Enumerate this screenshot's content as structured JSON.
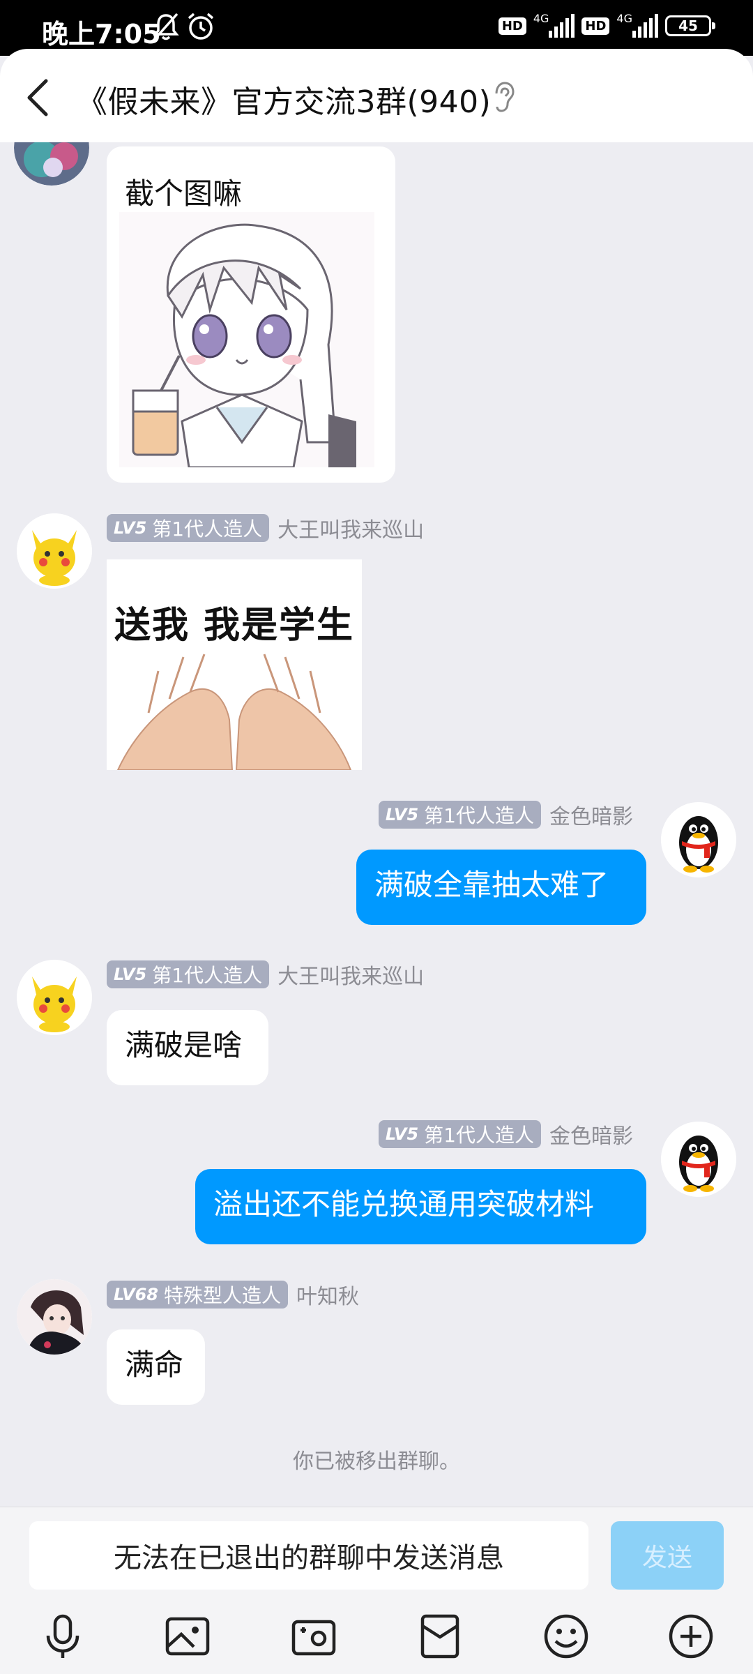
{
  "status_bar": {
    "time": "晚上7:05",
    "hd1": "HD",
    "net1": "4G",
    "hd2": "HD",
    "net2": "4G",
    "battery": "45"
  },
  "header": {
    "title": "《假未来》官方交流3群(940)"
  },
  "messages": [
    {
      "text": "截个图嘛"
    },
    {
      "badge_lv": "LV5",
      "badge_title": "第1代人造人",
      "sender": "大王叫我来巡山",
      "sticker_text": "送我 我是学生"
    },
    {
      "badge_lv": "LV5",
      "badge_title": "第1代人造人",
      "sender": "金色暗影",
      "text": "满破全靠抽太难了"
    },
    {
      "badge_lv": "LV5",
      "badge_title": "第1代人造人",
      "sender": "大王叫我来巡山",
      "text": "满破是啥"
    },
    {
      "badge_lv": "LV5",
      "badge_title": "第1代人造人",
      "sender": "金色暗影",
      "text": "溢出还不能兑换通用突破材料"
    },
    {
      "badge_lv": "LV68",
      "badge_title": "特殊型人造人",
      "sender": "叶知秋",
      "text": "满命"
    }
  ],
  "system_message": "你已被移出群聊。",
  "input": {
    "disabled_text": "无法在已退出的群聊中发送消息",
    "send_label": "发送"
  },
  "toolbar_icons": [
    "microphone-icon",
    "image-icon",
    "camera-icon",
    "red-packet-icon",
    "emoji-icon",
    "plus-icon"
  ],
  "colors": {
    "accent": "#0099ff",
    "send_disabled": "#8cd1f7",
    "badge": "#a8adbf",
    "background": "#ededf2"
  }
}
